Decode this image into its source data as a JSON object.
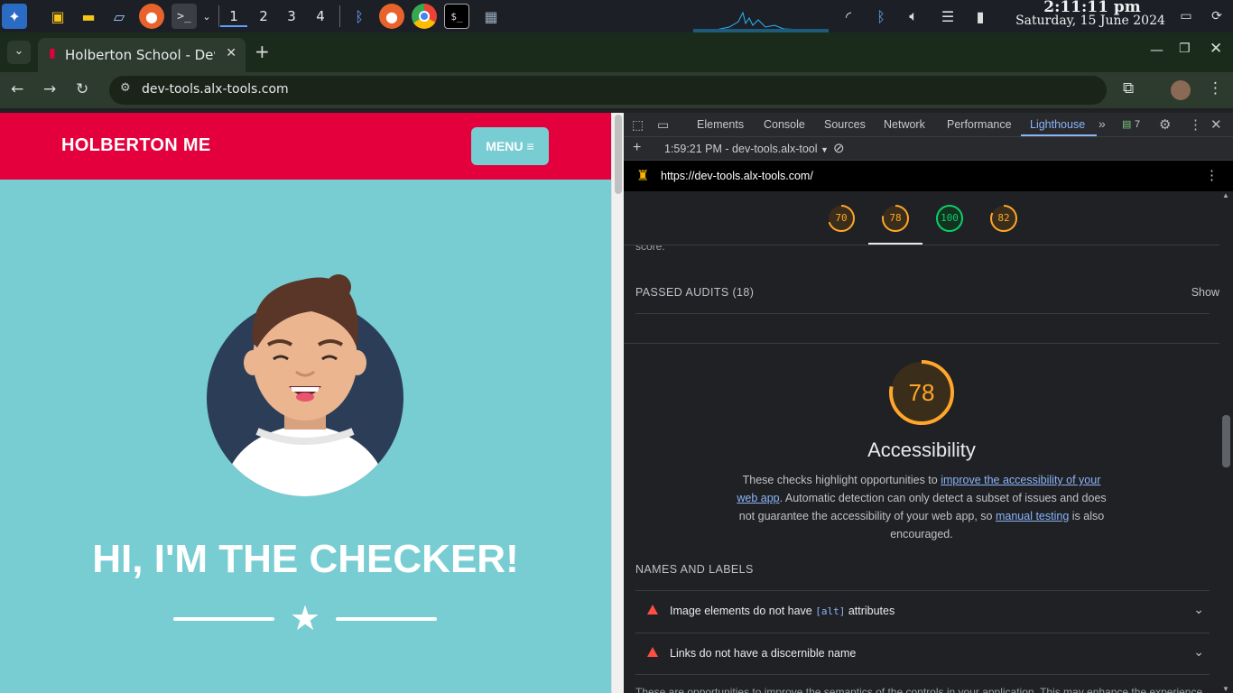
{
  "taskbar": {
    "workspaces": [
      "1",
      "2",
      "3",
      "4"
    ],
    "clock_time": "2:11:11 pm",
    "clock_date": "Saturday, 15 June 2024"
  },
  "browser": {
    "tab_title": "Holberton School - Dev",
    "url": "dev-tools.alx-tools.com"
  },
  "page": {
    "brand": "HOLBERTON ME",
    "menu_label": "MENU",
    "hero_title": "HI, I'M THE CHECKER!"
  },
  "devtools": {
    "tabs": [
      "Elements",
      "Console",
      "Sources",
      "Network",
      "Performance",
      "Lighthouse"
    ],
    "issues_count": "7",
    "report_selector": "1:59:21 PM - dev-tools.alx-tool",
    "report_url": "https://dev-tools.alx-tools.com/",
    "scores": [
      "70",
      "78",
      "100",
      "82"
    ],
    "score_note": "score.",
    "passed_audits": "PASSED AUDITS (18)",
    "show_label": "Show",
    "category_score": "78",
    "category_title": "Accessibility",
    "desc_part1": "These checks highlight opportunities to ",
    "desc_link1": "improve the accessibility of your web app",
    "desc_part2": ". Automatic detection can only detect a subset of issues and does not guarantee the accessibility of your web app, so ",
    "desc_link2": "manual testing",
    "desc_part3": " is also encouraged.",
    "group_title": "NAMES AND LABELS",
    "audit1_pre": "Image elements do not have ",
    "audit1_code": "[alt]",
    "audit1_post": " attributes",
    "audit2": "Links do not have a discernible name",
    "bottom_text": "These are opportunities to improve the semantics of the controls in your application. This may enhance the experience"
  },
  "colors": {
    "brand_red": "#e4003c",
    "teal": "#78cdd3",
    "score_orange": "#ffa62b",
    "score_green": "#0cce6b"
  }
}
